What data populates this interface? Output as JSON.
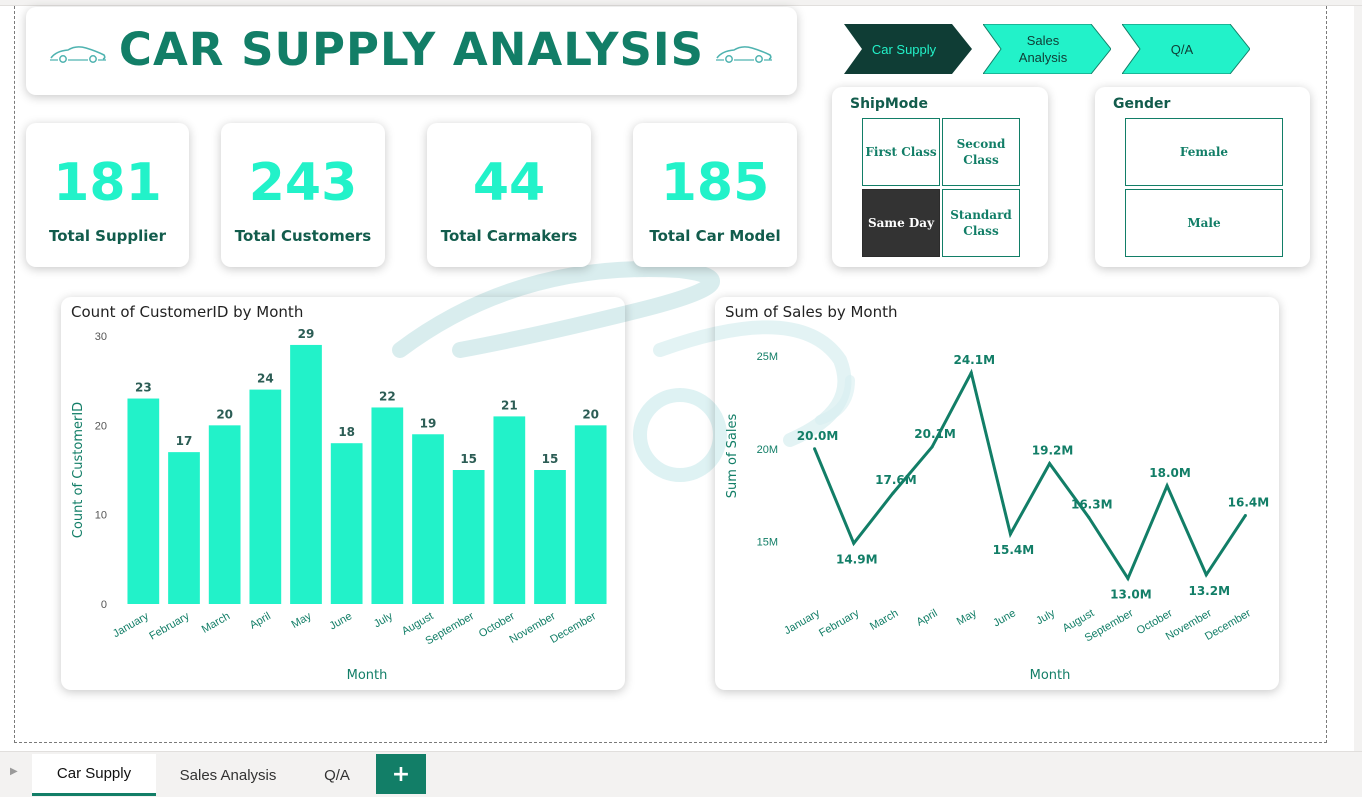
{
  "title": "CAR SUPPLY ANALYSIS",
  "nav": [
    {
      "label": "Car Supply",
      "active": true
    },
    {
      "label": "Sales Analysis",
      "active": false
    },
    {
      "label": "Q/A",
      "active": false
    }
  ],
  "kpis": [
    {
      "value": "181",
      "label": "Total Supplier"
    },
    {
      "value": "243",
      "label": "Total Customers"
    },
    {
      "value": "44",
      "label": "Total Carmakers"
    },
    {
      "value": "185",
      "label": "Total Car Model"
    }
  ],
  "shipmode": {
    "title": "ShipMode",
    "options": [
      "First Class",
      "Second Class",
      "Same Day",
      "Standard Class"
    ],
    "selected": "Same Day"
  },
  "gender": {
    "title": "Gender",
    "options": [
      "Female",
      "Male"
    ]
  },
  "colors": {
    "accent": "#22f2c9",
    "dark_green": "#127e67",
    "selected_tile": "#333333"
  },
  "chart_data": [
    {
      "type": "bar",
      "title": "Count of CustomerID by Month",
      "xlabel": "Month",
      "ylabel": "Count of CustomerID",
      "categories": [
        "January",
        "February",
        "March",
        "April",
        "May",
        "June",
        "July",
        "August",
        "September",
        "October",
        "November",
        "December"
      ],
      "values": [
        23,
        17,
        20,
        24,
        29,
        18,
        22,
        19,
        15,
        21,
        15,
        20
      ],
      "ylim": [
        0,
        30
      ],
      "yticks": [
        "0",
        "10",
        "20",
        "30"
      ],
      "data_labels": [
        "23",
        "17",
        "20",
        "24",
        "29",
        "18",
        "22",
        "19",
        "15",
        "21",
        "15",
        "20"
      ],
      "color": "#22f2c9"
    },
    {
      "type": "line",
      "title": "Sum of Sales by Month",
      "xlabel": "Month",
      "ylabel": "Sum of Sales",
      "categories": [
        "January",
        "February",
        "March",
        "April",
        "May",
        "June",
        "July",
        "August",
        "September",
        "October",
        "November",
        "December"
      ],
      "values": [
        20.0,
        14.9,
        17.6,
        20.1,
        24.1,
        15.4,
        19.2,
        16.3,
        13.0,
        18.0,
        13.2,
        16.4
      ],
      "unit": "M",
      "ylim": [
        12.0,
        25.6
      ],
      "yticks": [
        {
          "value": 15,
          "label": "15M"
        },
        {
          "value": 20,
          "label": "20M"
        },
        {
          "value": 25,
          "label": "25M"
        }
      ],
      "data_labels": [
        "20.0M",
        "14.9M",
        "17.6M",
        "20.1M",
        "24.1M",
        "15.4M",
        "19.2M",
        "16.3M",
        "13.0M",
        "18.0M",
        "13.2M",
        "16.4M"
      ],
      "color": "#127e67"
    }
  ],
  "tabs": [
    {
      "label": "Car Supply",
      "active": true
    },
    {
      "label": "Sales Analysis",
      "active": false
    },
    {
      "label": "Q/A",
      "active": false
    }
  ],
  "add_tab": "+"
}
